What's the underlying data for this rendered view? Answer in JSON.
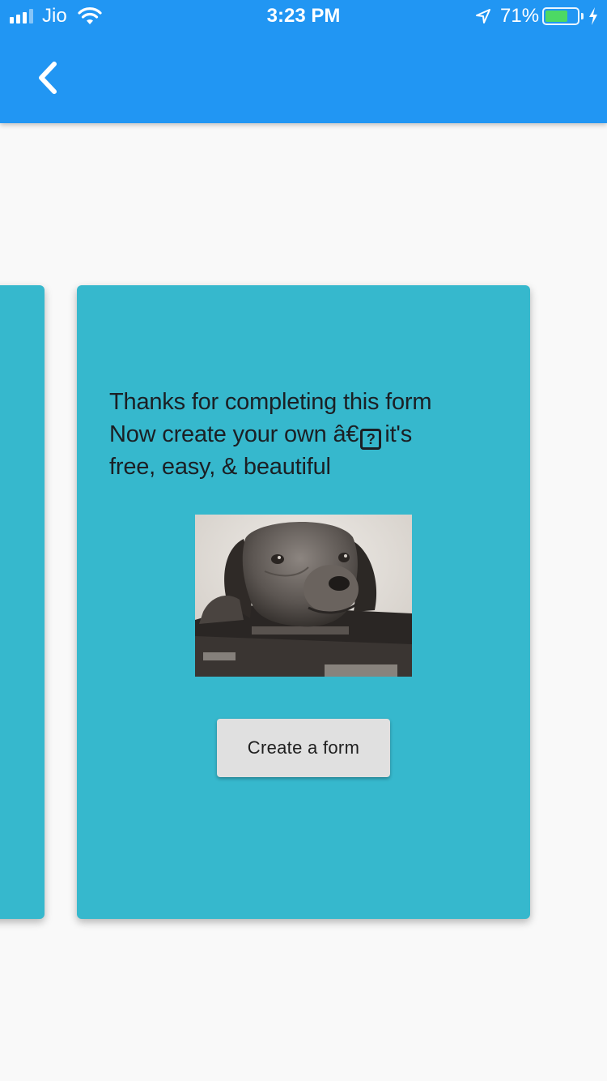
{
  "status_bar": {
    "carrier": "Jio",
    "time": "3:23 PM",
    "battery_percent": "71%",
    "battery_level": 0.71,
    "signal_bars": 4,
    "signal_bars_active": 3,
    "icons": [
      "signal-icon",
      "wifi-icon",
      "location-arrow-icon",
      "battery-icon",
      "charging-bolt-icon"
    ]
  },
  "app_bar": {
    "back_icon": "chevron-left-icon",
    "color": "#2196f3"
  },
  "card": {
    "background": "#36b8cd",
    "message_line1": "Thanks for completing this form",
    "message_line2_start": "Now create your own â€",
    "missing_glyph": "?",
    "message_line2_end": "it's",
    "message_line3": "free, easy, & beautiful",
    "image_subject": "sepia photo of a dog resting its head on a board game box",
    "button_label": "Create a form"
  }
}
